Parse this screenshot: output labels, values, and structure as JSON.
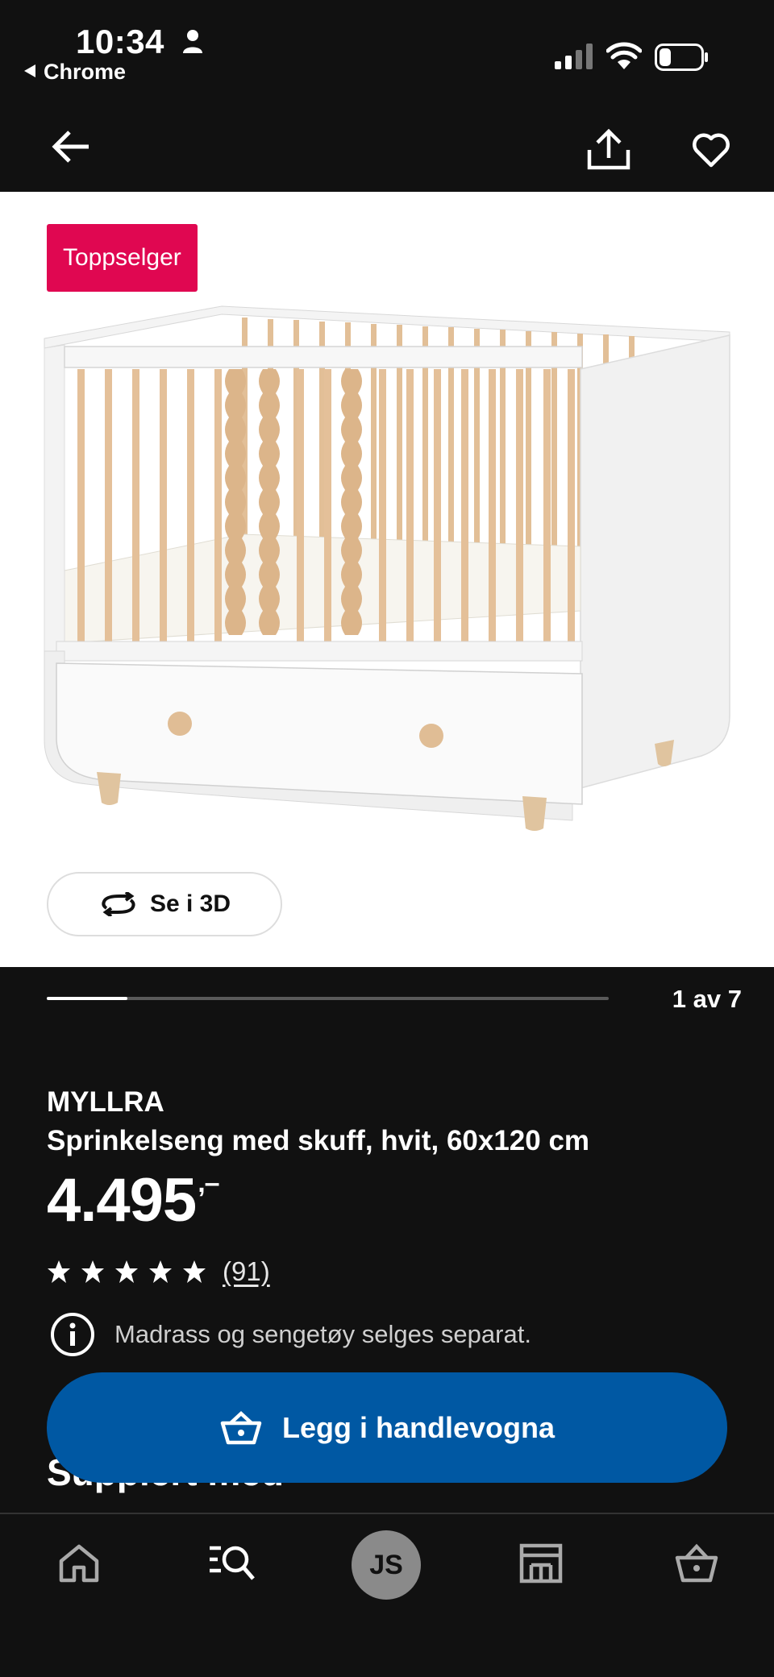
{
  "status_bar": {
    "time": "10:34",
    "back_app": "Chrome"
  },
  "top_nav": {
    "back_icon": "arrow-left-icon",
    "share_icon": "share-icon",
    "favorite_icon": "heart-icon"
  },
  "gallery": {
    "badge": "Toppselger",
    "view_3d_label": "Se i 3D",
    "counter": "1 av 7",
    "current": 1,
    "total": 7
  },
  "product": {
    "brand": "MYLLRA",
    "description": "Sprinkelseng med skuff, hvit, 60x120 cm",
    "price": "4.495",
    "price_suffix": ",–",
    "rating": 5,
    "rating_max": 5,
    "review_count": "(91)",
    "info_note": "Madrass og sengetøy selges separat."
  },
  "cta": {
    "label": "Legg i handlevogna"
  },
  "section_peek": "Supplert med",
  "tab_bar": {
    "avatar_initials": "JS",
    "tabs": [
      "home-icon",
      "search-icon",
      "avatar",
      "store-icon",
      "cart-icon"
    ]
  },
  "colors": {
    "background": "#111111",
    "badge": "#e00751",
    "cta": "#0058a3",
    "avatar": "#8a8a8a"
  }
}
